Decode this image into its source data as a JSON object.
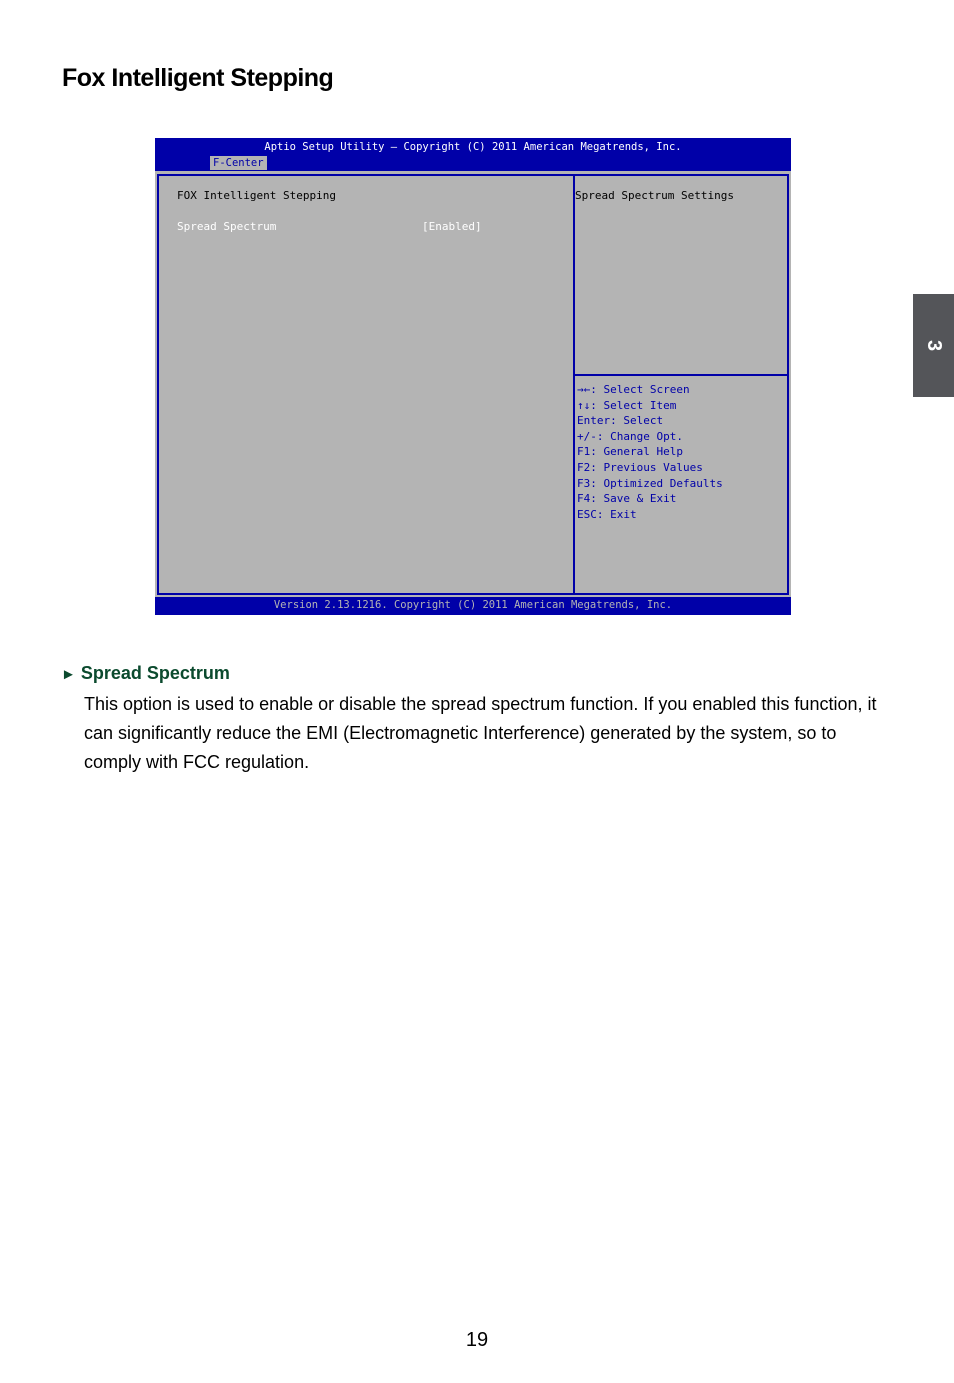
{
  "page": {
    "title": "Fox Intelligent Stepping",
    "chapter_tab": "3",
    "page_number": "19"
  },
  "bios": {
    "header": "Aptio Setup Utility – Copyright (C) 2011 American Megatrends, Inc.",
    "active_tab": "F-Center",
    "section_title": "FOX Intelligent Stepping",
    "items": [
      {
        "label": "Spread Spectrum",
        "value": "[Enabled]"
      }
    ],
    "help_text": "Spread Spectrum Settings",
    "keys": [
      "→←: Select Screen",
      "↑↓: Select Item",
      "Enter: Select",
      "+/-: Change Opt.",
      "F1: General Help",
      "F2: Previous Values",
      "F3: Optimized Defaults",
      "F4: Save & Exit",
      "ESC: Exit"
    ],
    "footer": "Version 2.13.1216. Copyright (C) 2011 American Megatrends, Inc.",
    "colors": {
      "blue": "#0000a8",
      "gray": "#b4b4b4",
      "white": "#ffffff"
    }
  },
  "section": {
    "arrow_icon": "►",
    "heading": "Spread Spectrum",
    "body": "This option is used to enable or disable the spread spectrum function. If you enabled this function, it can significantly reduce the EMI (Electromagnetic Interference) generated by the system, so to comply with FCC regulation.",
    "heading_color": "#0b4a2e"
  }
}
